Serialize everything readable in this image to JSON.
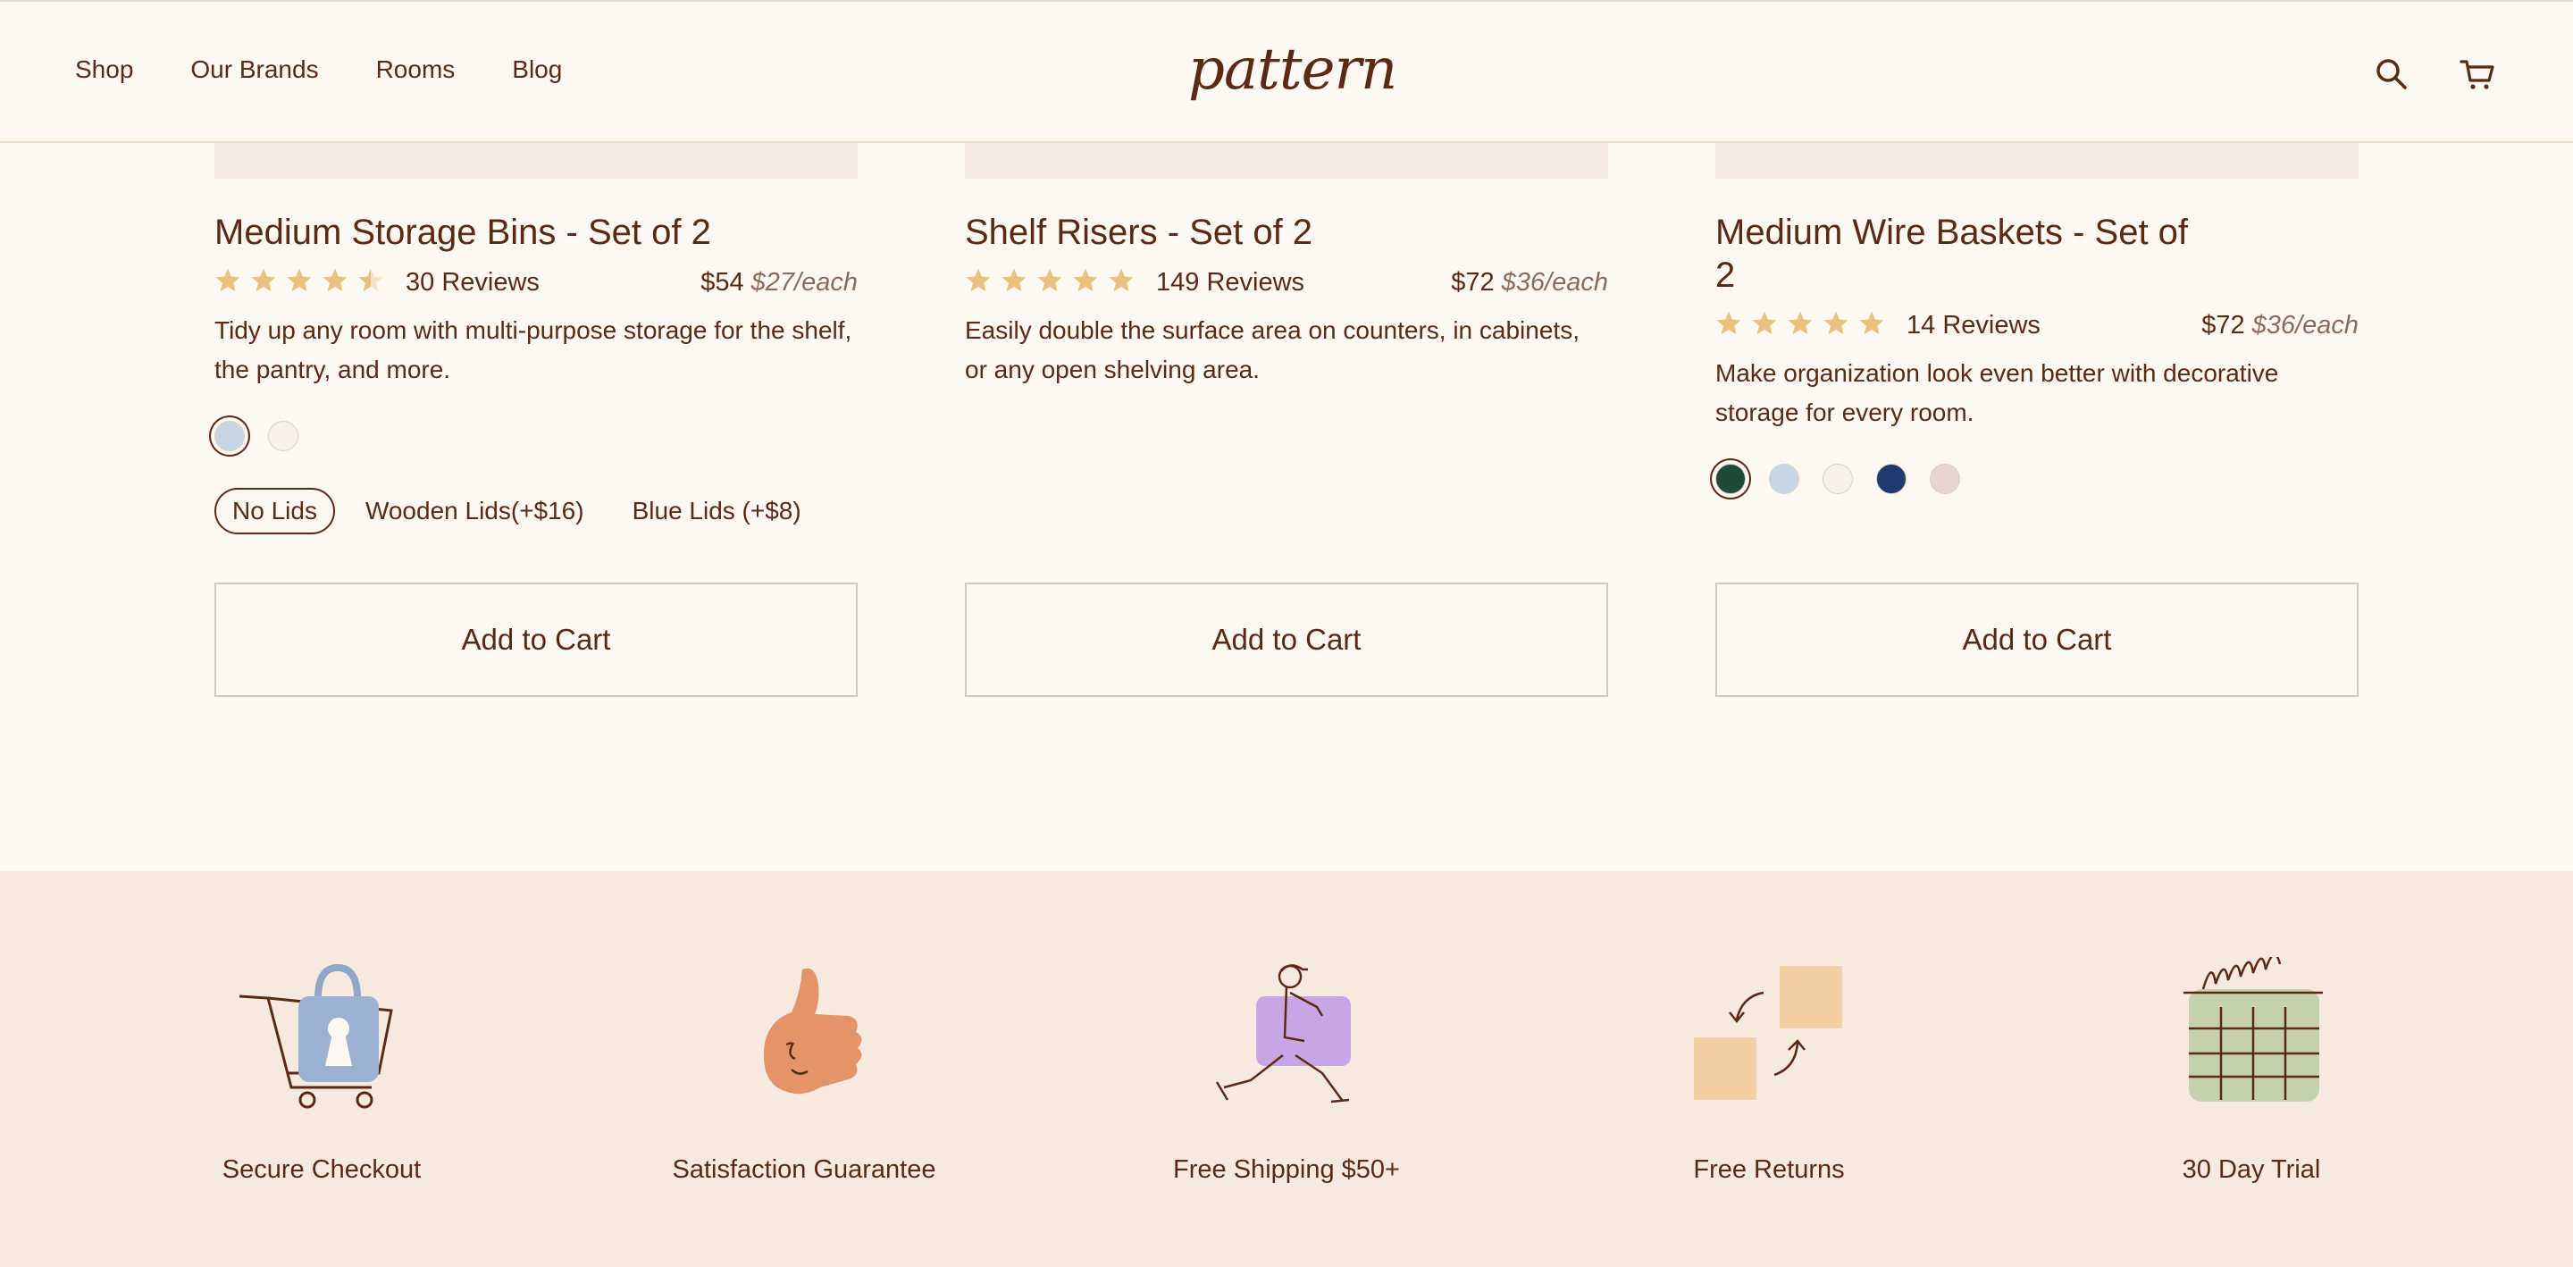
{
  "header": {
    "nav": [
      "Shop",
      "Our Brands",
      "Rooms",
      "Blog"
    ],
    "logo": "pattern",
    "search_icon": "search-icon",
    "cart_icon": "cart-icon"
  },
  "colors": {
    "brown": "#5a2a14",
    "star": "#ecc07f",
    "cream": "#fdf9f2",
    "band": "#f6eae0"
  },
  "products": [
    {
      "title": "Medium Storage Bins - Set of 2",
      "rating": 4.5,
      "reviews": "30 Reviews",
      "price": "$54",
      "each": "$27/each",
      "description": "Tidy up any room with multi-purpose storage for the shelf, the pantry, and more.",
      "swatches": [
        "#c9d6e6",
        "#f7f3ec"
      ],
      "selected_swatch": 0,
      "lid_options": [
        "No Lids",
        "Wooden Lids(+$16)",
        "Blue Lids (+$8)"
      ],
      "selected_lid": 0,
      "cta": "Add to Cart"
    },
    {
      "title": "Shelf Risers - Set of 2",
      "rating": 5,
      "reviews": "149 Reviews",
      "price": "$72",
      "each": "$36/each",
      "description": "Easily double the surface area on counters, in cabinets, or any open shelving area.",
      "cta": "Add to Cart"
    },
    {
      "title": "Medium Wire Baskets - Set of 2",
      "rating": 5,
      "reviews": "14 Reviews",
      "price": "$72",
      "each": "$36/each",
      "description": "Make organization look even better with decorative storage for every room.",
      "swatches": [
        "#1e4a37",
        "#c9d6e6",
        "#f7f3ec",
        "#1f3a6e",
        "#ead3d4"
      ],
      "selected_swatch": 0,
      "cta": "Add to Cart"
    }
  ],
  "benefits": [
    {
      "label": "Secure Checkout",
      "icon": "secure-checkout-icon"
    },
    {
      "label": "Satisfaction Guarantee",
      "icon": "thumbs-up-icon"
    },
    {
      "label": "Free Shipping $50+",
      "icon": "delivery-person-icon"
    },
    {
      "label": "Free Returns",
      "icon": "returns-boxes-icon"
    },
    {
      "label": "30 Day Trial",
      "icon": "calendar-icon"
    }
  ]
}
